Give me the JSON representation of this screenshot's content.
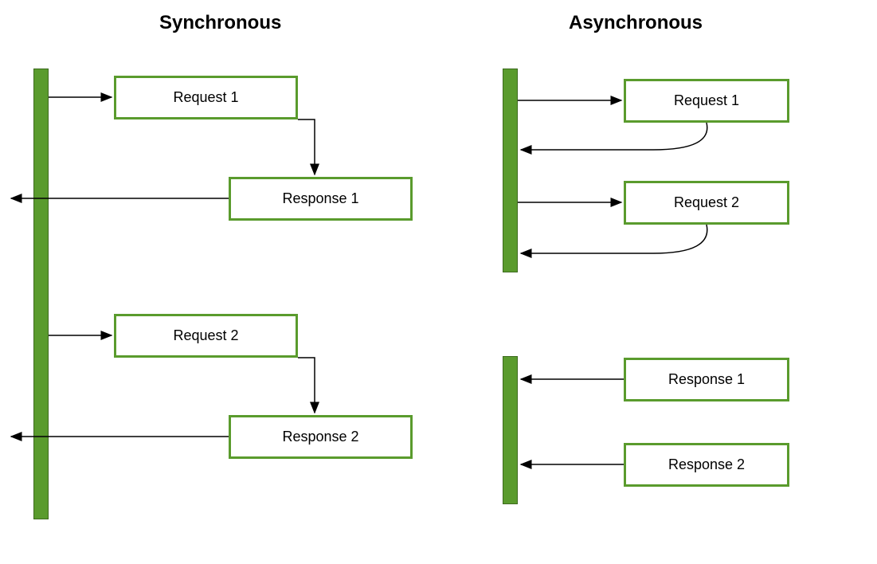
{
  "titles": {
    "synchronous": "Synchronous",
    "asynchronous": "Asynchronous"
  },
  "synchronous": {
    "boxes": {
      "request1": "Request 1",
      "response1": "Response 1",
      "request2": "Request 2",
      "response2": "Response 2"
    }
  },
  "asynchronous": {
    "boxes": {
      "request1": "Request 1",
      "request2": "Request 2",
      "response1": "Response 1",
      "response2": "Response 2"
    }
  },
  "colors": {
    "bar_fill": "#5a9b2d",
    "bar_border": "#3d6b1e",
    "box_border": "#5a9b2d",
    "arrow": "#000000"
  }
}
